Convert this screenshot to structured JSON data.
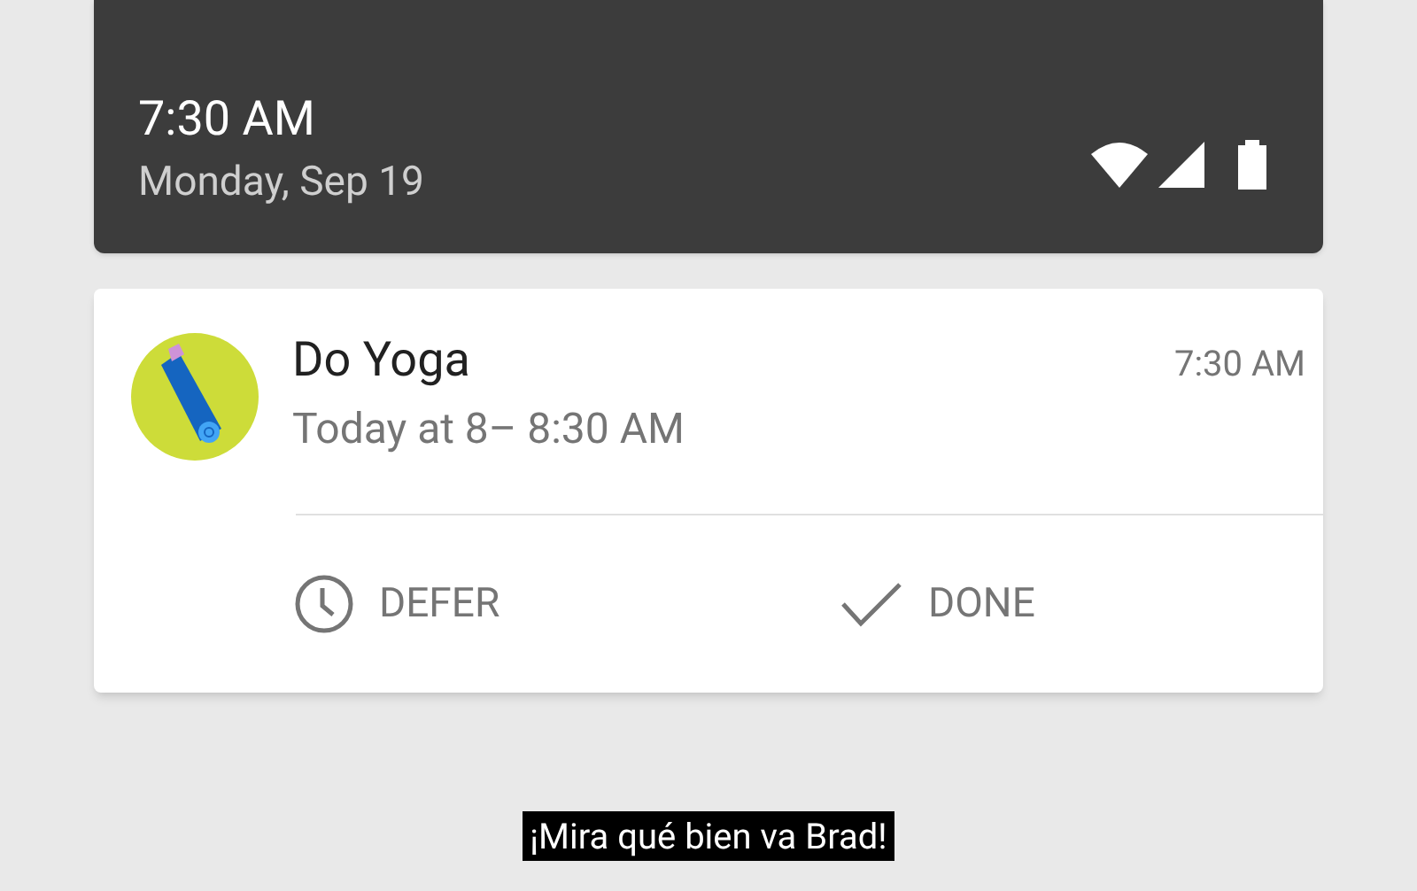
{
  "status_panel": {
    "time": "7:30 AM",
    "date": "Monday, Sep 19"
  },
  "notification": {
    "title": "Do Yoga",
    "subtitle": "Today at 8– 8:30 AM",
    "time": "7:30 AM",
    "actions": [
      {
        "kind": "clock",
        "label": "DEFER"
      },
      {
        "kind": "check",
        "label": "DONE"
      }
    ]
  },
  "caption": "¡Mira qué bien va Brad!"
}
